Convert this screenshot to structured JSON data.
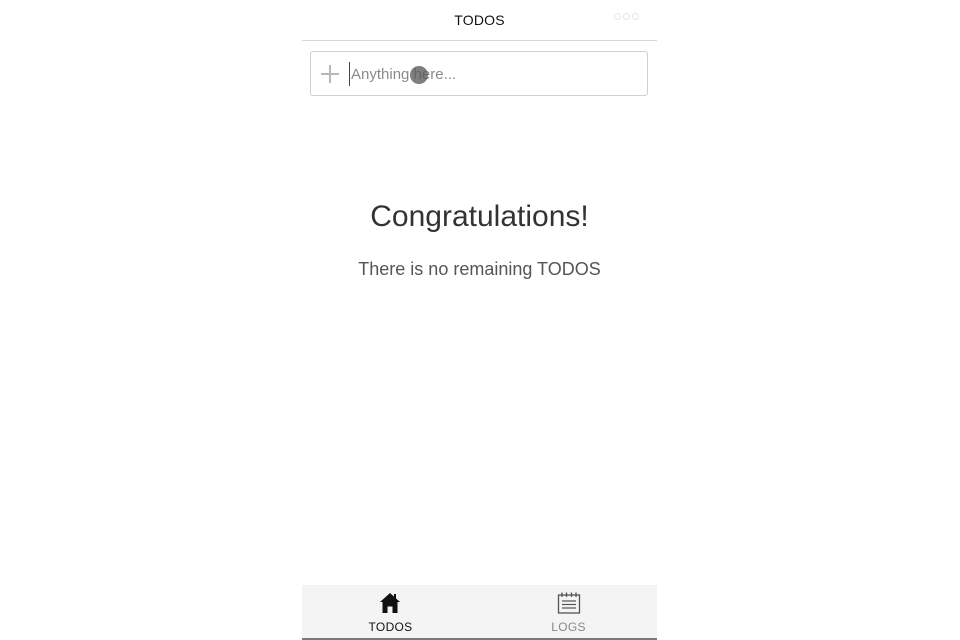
{
  "header": {
    "title": "TODOS",
    "more_icon": "more-icon"
  },
  "new_todo": {
    "placeholder": "Anything here...",
    "value": "",
    "icon": "plus-icon"
  },
  "empty_state": {
    "title": "Congratulations!",
    "subtitle": "There is no remaining TODOS"
  },
  "tabs": [
    {
      "label": "TODOS",
      "icon": "home-icon",
      "active": true
    },
    {
      "label": "LOGS",
      "icon": "calendar-icon",
      "active": false
    }
  ],
  "colors": {
    "active_tab": "#111111",
    "inactive_tab": "#888888",
    "tabbar_bg": "#f4f4f4"
  }
}
